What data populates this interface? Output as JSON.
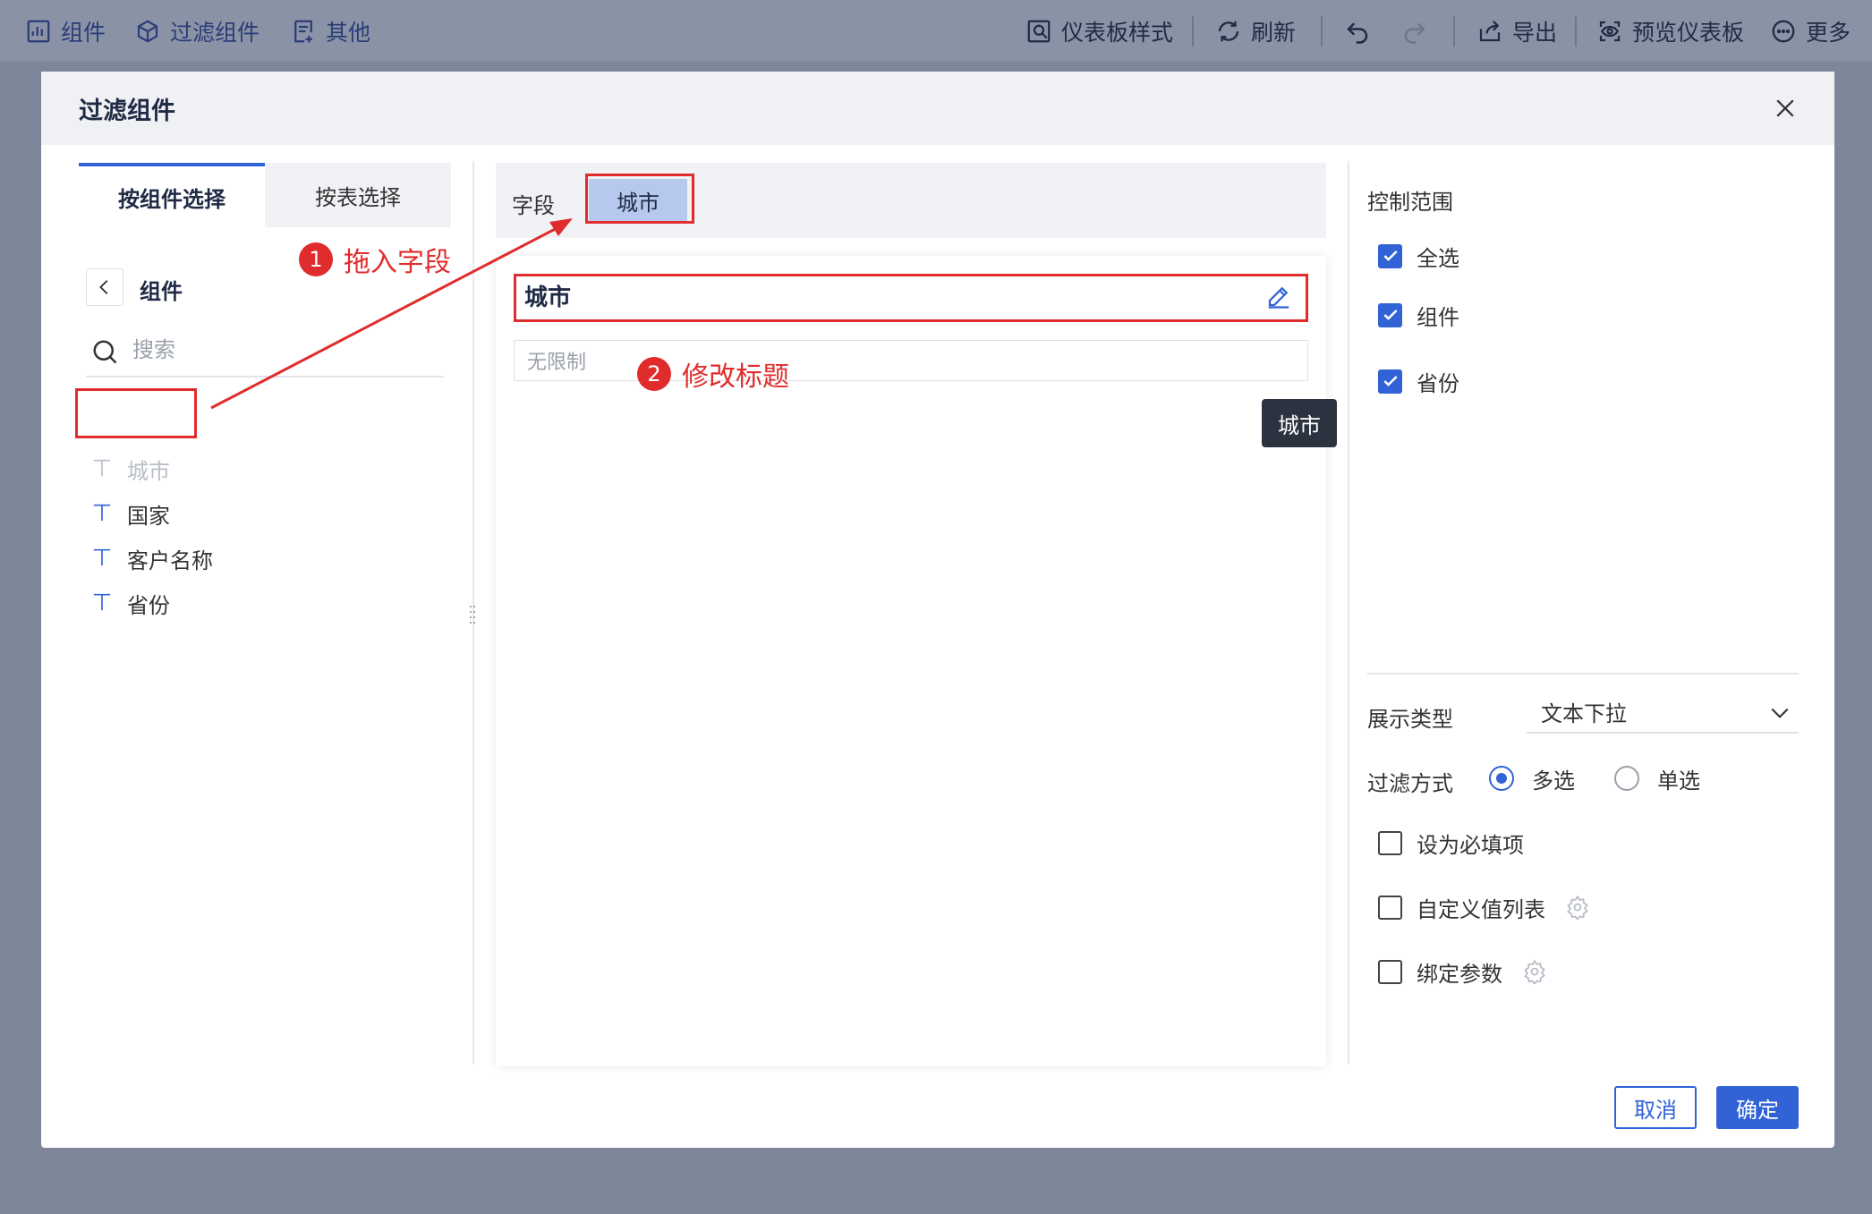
{
  "toolbar": {
    "components": "组件",
    "filter_components": "过滤组件",
    "other": "其他",
    "dashboard_style": "仪表板样式",
    "refresh": "刷新",
    "export": "导出",
    "preview_dashboard": "预览仪表板",
    "more": "更多"
  },
  "modal": {
    "title": "过滤组件",
    "tabs": [
      "按组件选择",
      "按表选择"
    ],
    "component_header": "组件",
    "search_placeholder": "搜索",
    "fields": [
      "城市",
      "国家",
      "客户名称",
      "省份"
    ],
    "field_label": "字段",
    "selected_field": "城市",
    "filter_title": "城市",
    "no_limit_placeholder": "无限制",
    "tooltip": "城市",
    "control_scope": {
      "label": "控制范围",
      "items": [
        {
          "label": "全选",
          "checked": true
        },
        {
          "label": "组件",
          "checked": true
        },
        {
          "label": "省份",
          "checked": true
        }
      ]
    },
    "display_type_label": "展示类型",
    "display_type_value": "文本下拉",
    "filter_mode_label": "过滤方式",
    "filter_mode_options": [
      "多选",
      "单选"
    ],
    "filter_mode_selected": "多选",
    "options": [
      {
        "label": "设为必填项",
        "checked": false
      },
      {
        "label": "自定义值列表",
        "checked": false
      },
      {
        "label": "绑定参数",
        "checked": false
      }
    ],
    "cancel": "取消",
    "confirm": "确定"
  },
  "annotations": {
    "step1": {
      "num": "1",
      "text": "拖入字段"
    },
    "step2": {
      "num": "2",
      "text": "修改标题"
    }
  },
  "colors": {
    "accent": "#3163d6",
    "annotation": "#e02c2c",
    "chip": "#b6c8ee"
  }
}
